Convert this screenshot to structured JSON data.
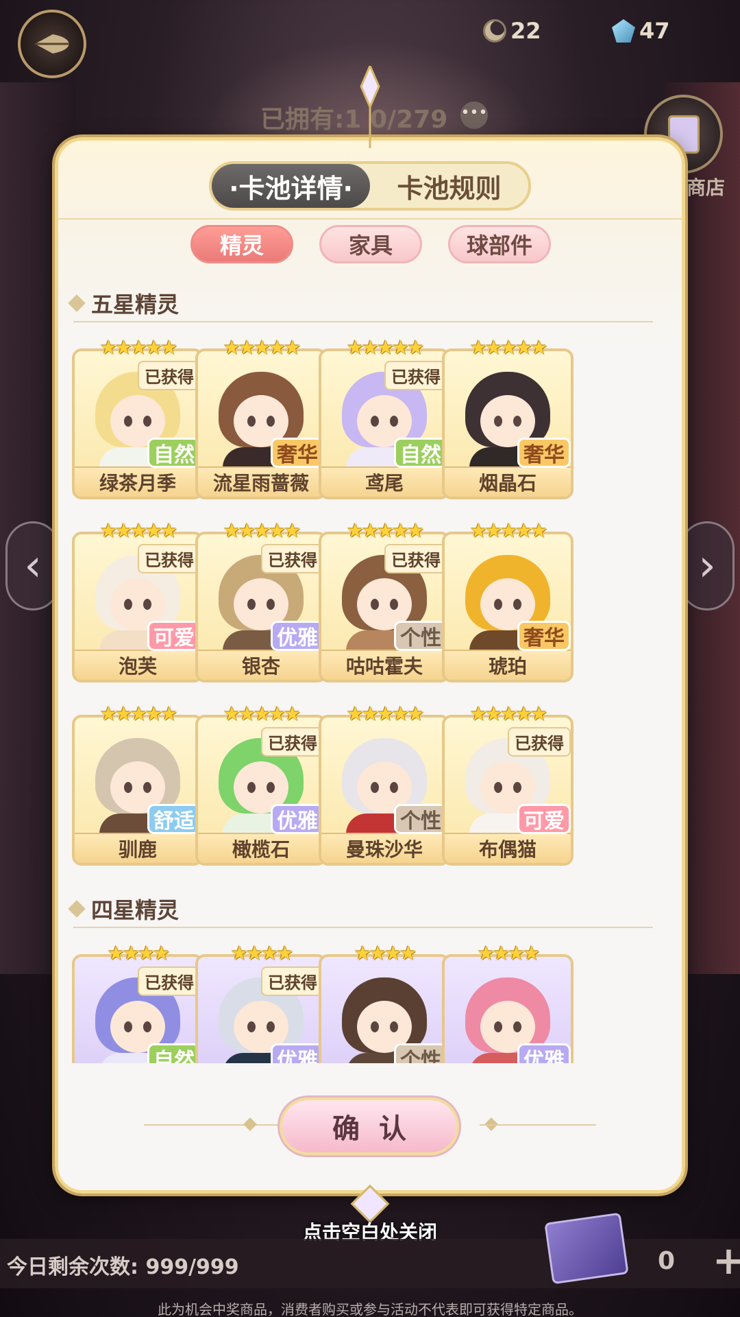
{
  "header": {
    "currencies": [
      {
        "icon": "moon-currency-icon",
        "value": "22"
      },
      {
        "icon": "gem-currency-icon",
        "value": "47"
      }
    ],
    "owned_text": "已拥有:1 0/279",
    "shop_label": "商店"
  },
  "modal": {
    "main_tabs": [
      {
        "label": "·卡池详情·",
        "active": true
      },
      {
        "label": "卡池规则",
        "active": false
      }
    ],
    "sub_tabs": [
      {
        "label": "精灵",
        "active": true
      },
      {
        "label": "家具",
        "active": false
      },
      {
        "label": "球部件",
        "active": false
      }
    ],
    "sections": [
      {
        "title": "五星精灵",
        "stars": "★★★★★",
        "cards": [
          {
            "name": "绿茶月季",
            "owned": "已获得",
            "tag": "自然"
          },
          {
            "name": "流星雨蔷薇",
            "owned": "",
            "tag": "奢华"
          },
          {
            "name": "鸢尾",
            "owned": "已获得",
            "tag": "自然"
          },
          {
            "name": "烟晶石",
            "owned": "",
            "tag": "奢华"
          },
          {
            "name": "泡芙",
            "owned": "已获得",
            "tag": "可爱"
          },
          {
            "name": "银杏",
            "owned": "已获得",
            "tag": "优雅"
          },
          {
            "name": "咕咕霍夫",
            "owned": "已获得",
            "tag": "个性"
          },
          {
            "name": "琥珀",
            "owned": "",
            "tag": "奢华"
          },
          {
            "name": "驯鹿",
            "owned": "",
            "tag": "舒适"
          },
          {
            "name": "橄榄石",
            "owned": "已获得",
            "tag": "优雅"
          },
          {
            "name": "曼珠沙华",
            "owned": "",
            "tag": "个性"
          },
          {
            "name": "布偶猫",
            "owned": "已获得",
            "tag": "可爱"
          }
        ]
      },
      {
        "title": "四星精灵",
        "stars": "★★★★",
        "cards": [
          {
            "name": "",
            "owned": "已获得",
            "tag": "自然"
          },
          {
            "name": "",
            "owned": "已获得",
            "tag": "优雅"
          },
          {
            "name": "",
            "owned": "",
            "tag": "个性"
          },
          {
            "name": "",
            "owned": "",
            "tag": "优雅"
          }
        ]
      }
    ],
    "confirm_label": "确认"
  },
  "close_hint": "点击空白处关闭",
  "footer": {
    "remaining": "今日剩余次数: 999/999",
    "count": "0",
    "plus": "+",
    "disclaimer": "此为机会中奖商品，消费者购买或参与活动不代表即可获得特定商品。"
  },
  "colors": {
    "nature": "#9ccf5e",
    "luxury": "#f9c865",
    "cute": "#ff99a8",
    "elegant": "#b7aaf2",
    "unique": "#d8c7b2",
    "comfy": "#8dcbf0",
    "active_tab": "#4c4948",
    "active_sub_tab": "#ea7a78"
  }
}
